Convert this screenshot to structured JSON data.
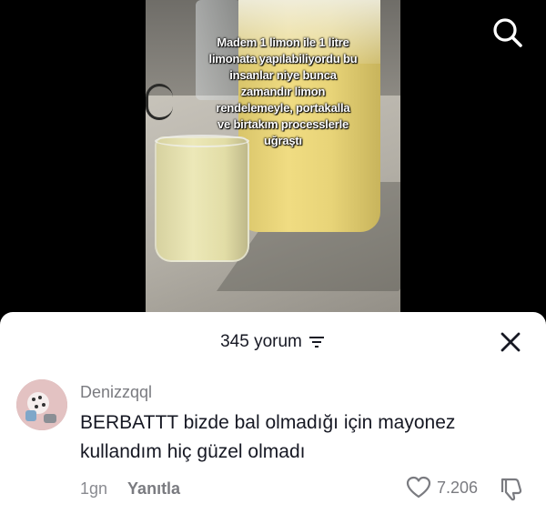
{
  "video": {
    "overlay_caption": "Madem 1 limon ile 1 litre\nlimonata yapılabiliyordu bu\ninsanlar niye bunca\nzamandır limon\nrendelemeyle, portakalla\nve birtakım processlerle\nuğraştı"
  },
  "top_bar": {
    "search_icon": "search-icon"
  },
  "comments_sheet": {
    "count_label": "345 yorum",
    "sort_icon": "sort-icon",
    "close_icon": "close-icon",
    "comments": [
      {
        "username": "Denizzqql",
        "text": "BERBATTT bizde bal olmadığı için mayonez kullandım hiç güzel olmadı",
        "time": "1gn",
        "reply_label": "Yanıtla",
        "like_count": "7.206"
      }
    ]
  },
  "colors": {
    "sheet_bg": "#ffffff",
    "text_primary": "#161823",
    "text_secondary": "#7a7b80"
  }
}
